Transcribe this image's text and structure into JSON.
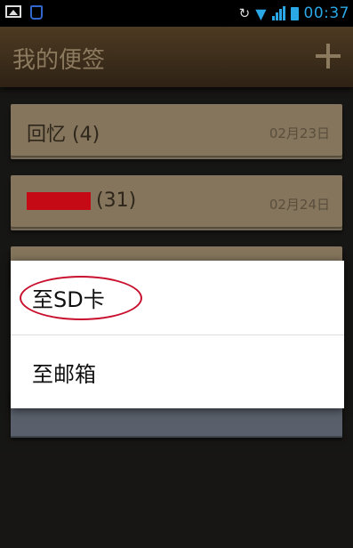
{
  "status_bar": {
    "time": "00:37",
    "icons": [
      "image-icon",
      "bag-icon",
      "vibrate-icon",
      "wifi-icon",
      "signal-icon",
      "battery-icon"
    ]
  },
  "header": {
    "title": "我的便签",
    "add_icon": "plus-icon"
  },
  "notes": [
    {
      "title": "回忆 (4)",
      "date": "02月23日"
    },
    {
      "title_suffix": "(31)",
      "date": "02月24日"
    }
  ],
  "popup_menu": {
    "items": [
      {
        "label": "至SD卡"
      },
      {
        "label": "至邮箱"
      }
    ]
  },
  "colors": {
    "accent_blue": "#2aa7e5",
    "note_card": "#a18f71",
    "annotation_red": "#c8102e",
    "redaction": "#f20d1a"
  }
}
